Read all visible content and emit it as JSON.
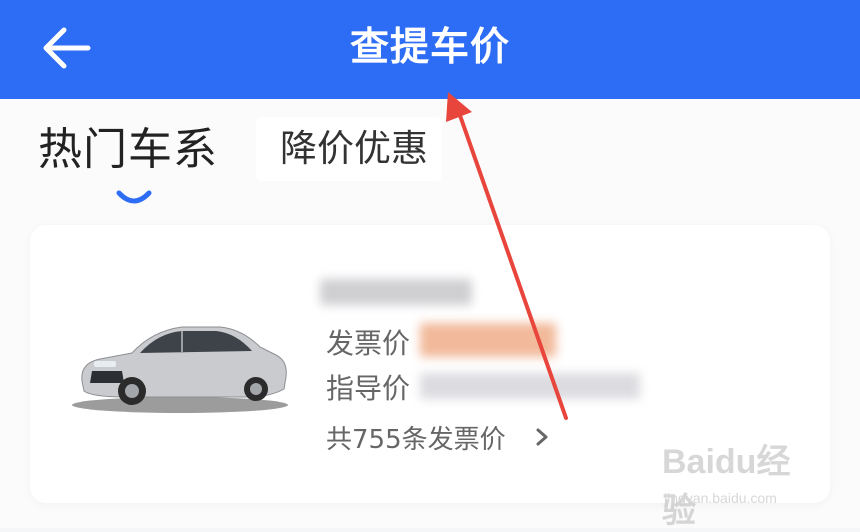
{
  "header": {
    "title": "查提车价",
    "back_icon": "back-arrow-icon",
    "color": "#2d6cf5"
  },
  "tabs": [
    {
      "label": "热门车系",
      "active": true
    },
    {
      "label": "降价优惠",
      "active": false
    }
  ],
  "card": {
    "car_image": "car-image",
    "invoice_label": "发票价",
    "guide_label": "指导价",
    "invoice_count": "共755条发票价",
    "chevron_icon": "chevron-right-icon"
  },
  "annotation": {
    "color": "#e8453c"
  },
  "watermark": {
    "brand": "Baidu经验",
    "sub": "jingyan.baidu.com"
  }
}
